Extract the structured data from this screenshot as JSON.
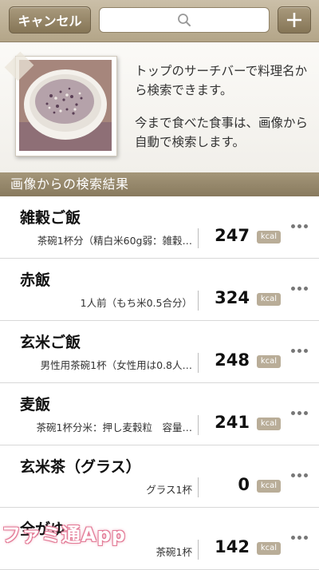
{
  "header": {
    "cancel_label": "キャンセル",
    "search_placeholder": "",
    "add_label": "+"
  },
  "info": {
    "line1": "トップのサーチバーで料理名から検索できます。",
    "line2": "今まで食べた食事は、画像から自動で検索します。"
  },
  "section_title": "画像からの検索結果",
  "results": [
    {
      "name": "雑穀ご飯",
      "portion": "茶碗1杯分（精白米60g弱：雑穀…",
      "calories": "247",
      "unit": "kcal"
    },
    {
      "name": "赤飯",
      "portion": "1人前（もち米0.5合分）",
      "calories": "324",
      "unit": "kcal"
    },
    {
      "name": "玄米ご飯",
      "portion": "男性用茶碗1杯（女性用は0.8人…",
      "calories": "248",
      "unit": "kcal"
    },
    {
      "name": "麦飯",
      "portion": "茶碗1杯分米：押し麦穀粒　容量…",
      "calories": "241",
      "unit": "kcal"
    },
    {
      "name": "玄米茶（グラス）",
      "portion": "グラス1杯",
      "calories": "0",
      "unit": "kcal"
    },
    {
      "name": "全がゆ",
      "portion": "茶碗1杯",
      "calories": "142",
      "unit": "kcal"
    }
  ],
  "watermark": "ファミ通App"
}
